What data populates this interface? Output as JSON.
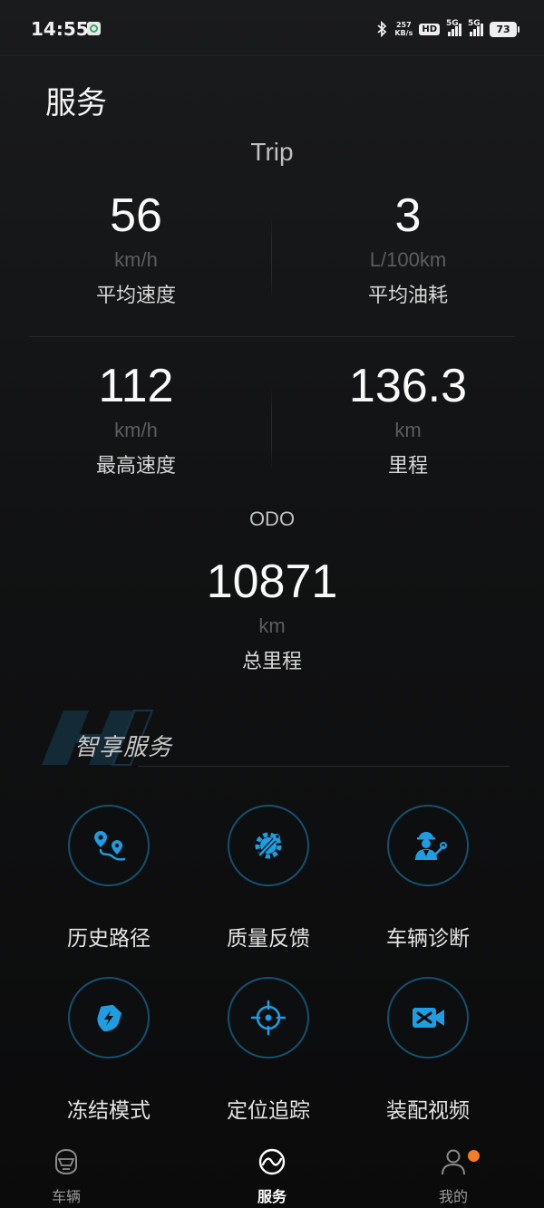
{
  "status_bar": {
    "time": "14:55",
    "net_speed_value": "257",
    "net_speed_unit": "KB/s",
    "hd_label": "HD",
    "sim1_label": "5G",
    "sim2_label": "5G",
    "battery": "73"
  },
  "page": {
    "title": "服务"
  },
  "trip": {
    "label": "Trip",
    "stats": [
      {
        "value": "56",
        "unit": "km/h",
        "label": "平均速度"
      },
      {
        "value": "3",
        "unit": "L/100km",
        "label": "平均油耗"
      },
      {
        "value": "112",
        "unit": "km/h",
        "label": "最高速度"
      },
      {
        "value": "136.3",
        "unit": "km",
        "label": "里程"
      }
    ]
  },
  "odo": {
    "label": "ODO",
    "value": "10871",
    "unit": "km",
    "caption": "总里程"
  },
  "smart_services": {
    "title": "智享服务",
    "items": [
      {
        "label": "历史路径",
        "icon": "route-pin-icon"
      },
      {
        "label": "质量反馈",
        "icon": "gear-wrench-icon"
      },
      {
        "label": "车辆诊断",
        "icon": "mechanic-icon"
      },
      {
        "label": "冻结模式",
        "icon": "lightning-shield-icon"
      },
      {
        "label": "定位追踪",
        "icon": "target-crosshair-icon"
      },
      {
        "label": "装配视频",
        "icon": "video-tools-icon"
      }
    ],
    "accent_color": "#1f9de0"
  },
  "bottom_nav": {
    "items": [
      {
        "label": "车辆",
        "icon": "motorcycle-helmet-icon",
        "active": false
      },
      {
        "label": "服务",
        "icon": "service-wave-icon",
        "active": true
      },
      {
        "label": "我的",
        "icon": "user-icon",
        "active": false,
        "badge_color": "#f37b2a"
      }
    ]
  }
}
